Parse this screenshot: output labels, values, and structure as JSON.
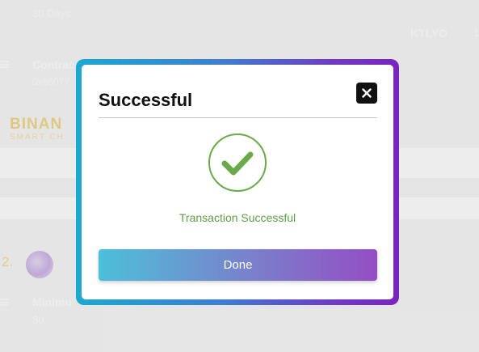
{
  "background": {
    "period_value": "30 Days",
    "token_symbol": "KTLYO",
    "token_value_fragment": "1",
    "contract_label": "Contrac",
    "contract_address_fragment": "0x96077",
    "chain_name": "BINAN",
    "chain_subname": "SMART CH",
    "item_index": "2.",
    "minimum_label": "Minimu",
    "minimum_value": "30"
  },
  "modal": {
    "title": "Successful",
    "status_text": "Transaction Successful",
    "done_label": "Done",
    "close_icon": "close-icon",
    "success_icon": "check-circle-icon",
    "colors": {
      "success": "#6aaa4a",
      "frame_start": "#1ba9cf",
      "frame_end": "#7a23bf"
    }
  }
}
